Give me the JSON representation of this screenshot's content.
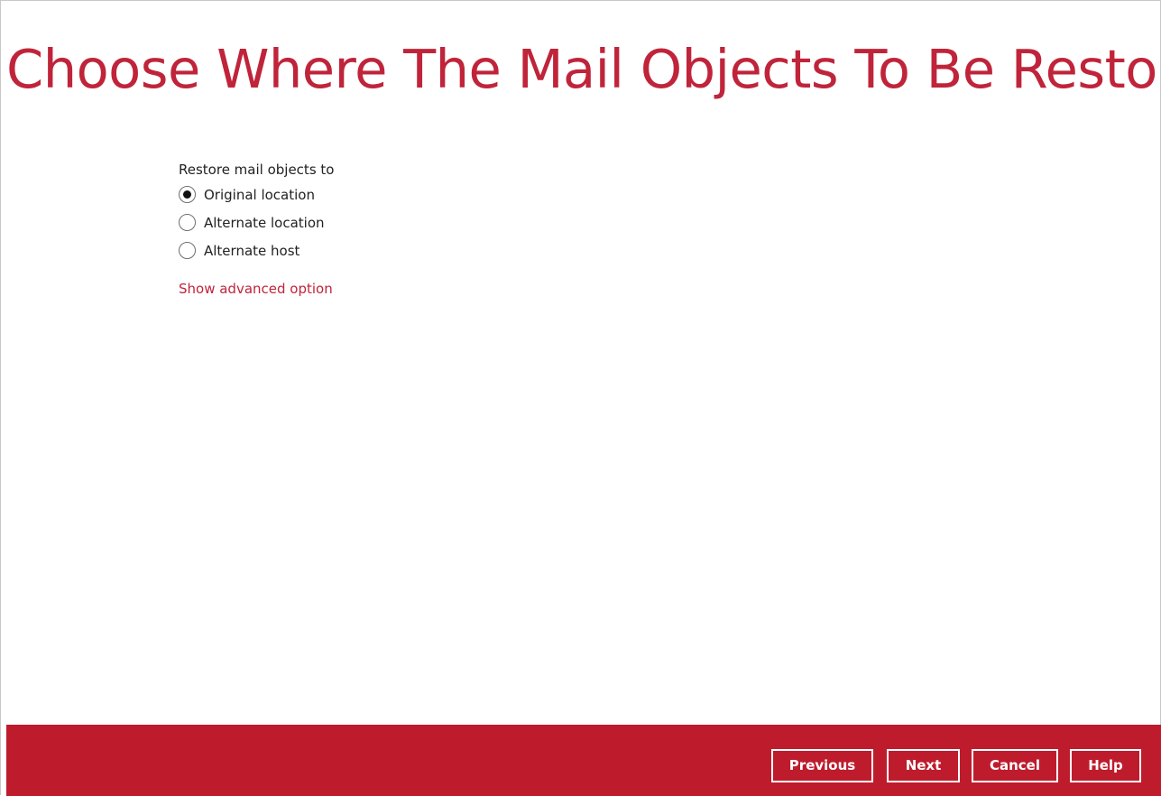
{
  "page": {
    "title": "Choose Where The Mail Objects To Be Restor..."
  },
  "restore": {
    "group_label": "Restore mail objects to",
    "options": [
      {
        "label": "Original location",
        "selected": true
      },
      {
        "label": "Alternate location",
        "selected": false
      },
      {
        "label": "Alternate host",
        "selected": false
      }
    ],
    "advanced_link": "Show advanced option"
  },
  "footer": {
    "previous_label": "Previous",
    "next_label": "Next",
    "cancel_label": "Cancel",
    "help_label": "Help"
  },
  "colors": {
    "accent": "#c0243a",
    "footer_bg": "#be1c2d"
  }
}
